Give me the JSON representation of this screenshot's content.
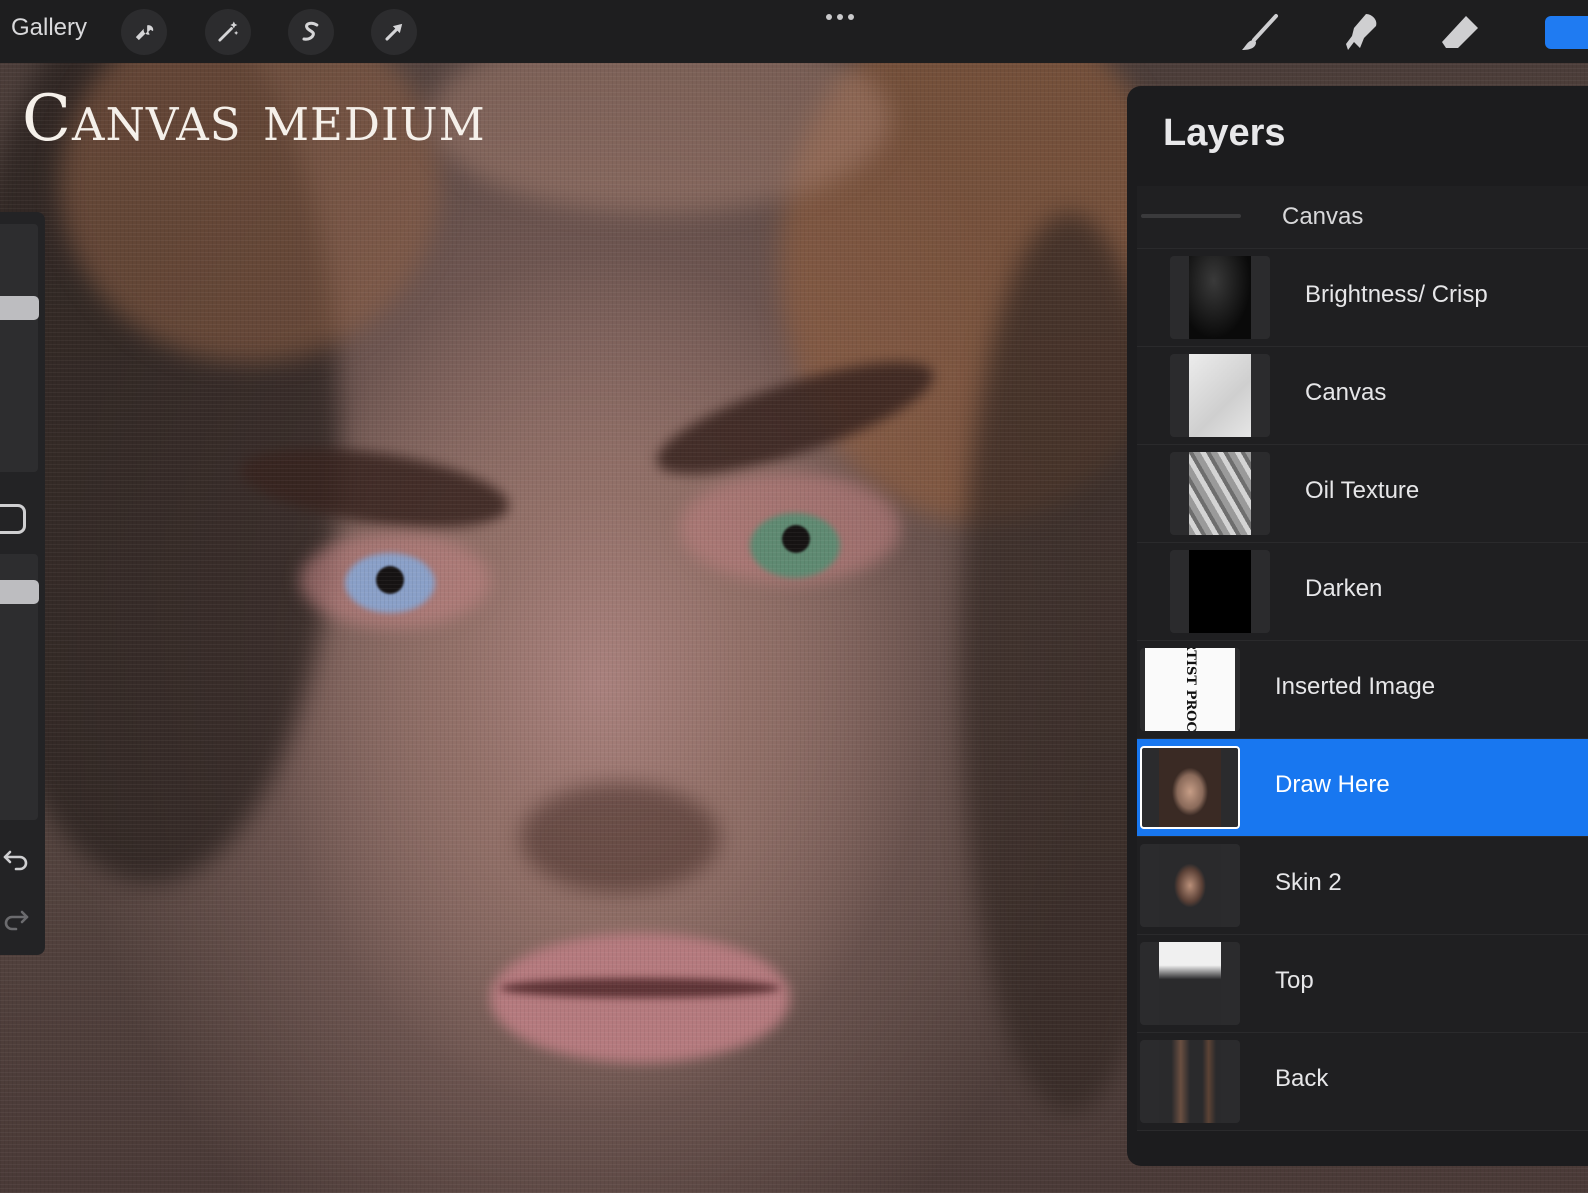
{
  "toolbar": {
    "gallery_label": "Gallery",
    "left_tools": [
      {
        "icon": "wrench-icon",
        "name": "actions"
      },
      {
        "icon": "magic-wand-icon",
        "name": "adjustments"
      },
      {
        "icon": "selection-icon",
        "name": "selection"
      },
      {
        "icon": "arrow-cursor-icon",
        "name": "transform"
      }
    ],
    "right_tools": [
      {
        "icon": "brush-icon",
        "name": "paint"
      },
      {
        "icon": "smudge-icon",
        "name": "smudge"
      },
      {
        "icon": "eraser-icon",
        "name": "erase"
      }
    ],
    "accent_color": "#1877f0"
  },
  "canvas": {
    "overlay_title": "Canvas medium"
  },
  "layers_panel": {
    "title": "Layers",
    "group": {
      "name": "Canvas"
    },
    "layers": [
      {
        "name": "Brightness/ Crisp",
        "thumb": "brightness",
        "indent": true,
        "selected": false
      },
      {
        "name": "Canvas",
        "thumb": "canvas",
        "indent": true,
        "selected": false
      },
      {
        "name": "Oil Texture",
        "thumb": "oil",
        "indent": true,
        "selected": false
      },
      {
        "name": "Darken",
        "thumb": "darken",
        "indent": true,
        "selected": false
      },
      {
        "name": "Inserted Image",
        "thumb": "inserted",
        "indent": false,
        "selected": false
      },
      {
        "name": "Draw Here",
        "thumb": "face",
        "indent": false,
        "selected": true
      },
      {
        "name": "Skin 2",
        "thumb": "skin",
        "indent": false,
        "selected": false
      },
      {
        "name": "Top",
        "thumb": "top",
        "indent": false,
        "selected": false
      },
      {
        "name": "Back",
        "thumb": "back",
        "indent": false,
        "selected": false
      }
    ],
    "inserted_thumb_text": "OIL ARTIST PROCREATE"
  }
}
